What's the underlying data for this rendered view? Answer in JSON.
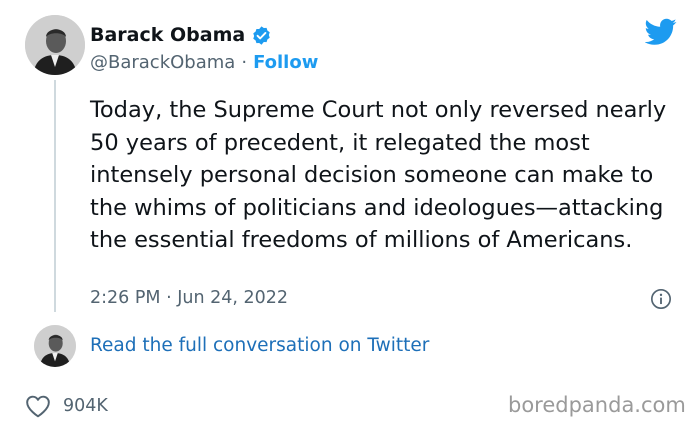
{
  "author": {
    "name": "Barack Obama",
    "handle": "@BarackObama",
    "separator": "·",
    "follow_label": "Follow"
  },
  "icons": {
    "verified": "verified-badge-icon",
    "brand": "twitter-bird-icon",
    "info": "info-icon",
    "like": "heart-icon"
  },
  "colors": {
    "accent": "#1d9bf0",
    "link": "#1d6fb8",
    "text": "#0f1419",
    "muted": "#536471"
  },
  "tweet": {
    "text": "Today, the Supreme Court not only reversed nearly 50 years of precedent, it relegated the most intensely personal decision someone can make to the whims of politicians and ideologues—attacking the essential freedoms of millions of Americans.",
    "timestamp": "2:26 PM · Jun 24, 2022"
  },
  "conversation_link": "Read the full conversation on Twitter",
  "likes": "904K",
  "watermark": "boredpanda.com"
}
